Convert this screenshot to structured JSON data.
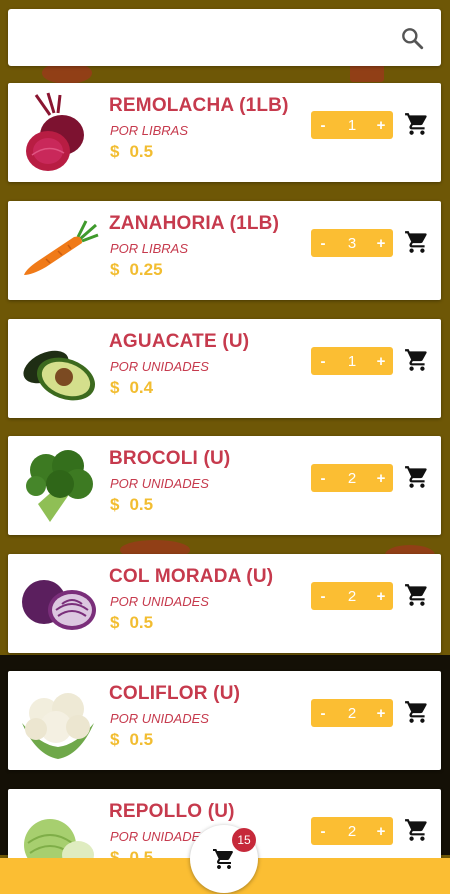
{
  "search": {
    "value": "",
    "placeholder": ""
  },
  "products": [
    {
      "name": "REMOLACHA (1LB)",
      "unit": "POR LIBRAS",
      "currency": "$",
      "price": "0.5",
      "qty": "1",
      "image": "beet"
    },
    {
      "name": "ZANAHORIA (1LB)",
      "unit": "POR LIBRAS",
      "currency": "$",
      "price": "0.25",
      "qty": "3",
      "image": "carrot"
    },
    {
      "name": "AGUACATE (U)",
      "unit": "POR UNIDADES",
      "currency": "$",
      "price": "0.4",
      "qty": "1",
      "image": "avocado"
    },
    {
      "name": "BROCOLI (U)",
      "unit": "POR UNIDADES",
      "currency": "$",
      "price": "0.5",
      "qty": "2",
      "image": "broccoli"
    },
    {
      "name": "COL MORADA (U)",
      "unit": "POR UNIDADES",
      "currency": "$",
      "price": "0.5",
      "qty": "2",
      "image": "red-cabbage"
    },
    {
      "name": "COLIFLOR (U)",
      "unit": "POR UNIDADES",
      "currency": "$",
      "price": "0.5",
      "qty": "2",
      "image": "cauliflower"
    },
    {
      "name": "REPOLLO (U)",
      "unit": "POR UNIDADES",
      "currency": "$",
      "price": "0.5",
      "qty": "2",
      "image": "cabbage"
    }
  ],
  "stepper": {
    "minus": "-",
    "plus": "+"
  },
  "cart": {
    "count": "15"
  },
  "icons": {
    "search": "search-icon",
    "cart": "cart-icon"
  },
  "colors": {
    "accent": "#fbbe33",
    "title": "#c63a4d",
    "price": "#f2bd31",
    "badge": "#c6293a"
  }
}
